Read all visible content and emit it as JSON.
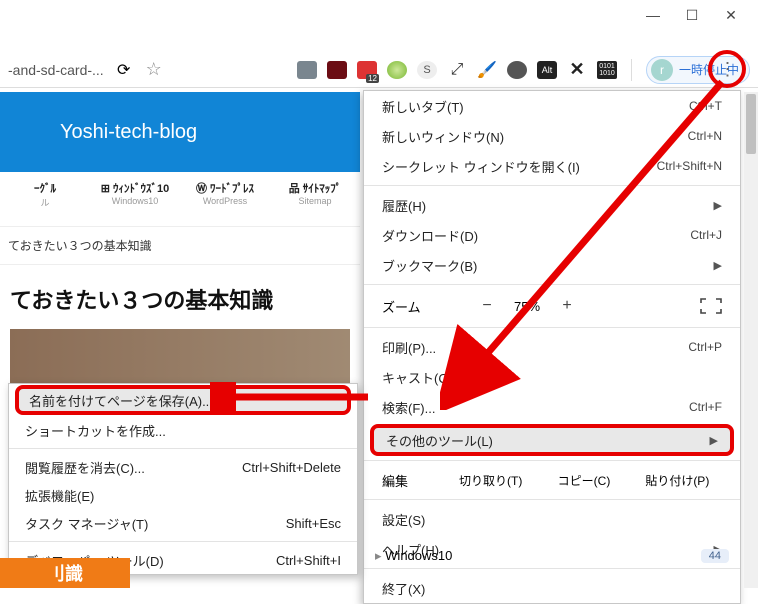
{
  "window": {
    "minimize": "—",
    "maximize": "☐",
    "close": "✕"
  },
  "toolbar": {
    "address_fragment": "-and-sd-card-...",
    "profile_initial": "r",
    "profile_label": "一時停止中"
  },
  "hero": {
    "title": "Yoshi-tech-blog"
  },
  "nav": [
    {
      "icon": "⊞",
      "label": "ｰｸﾞﾙ",
      "sub": "ル"
    },
    {
      "icon": "⊞",
      "label": "ｳｨﾝﾄﾞｳｽﾞ10",
      "sub": "Windows10"
    },
    {
      "icon": "Ⓦ",
      "label": "ﾜｰﾄﾞﾌﾟﾚｽ",
      "sub": "WordPress"
    },
    {
      "icon": "品",
      "label": "ｻｲﾄﾏｯﾌﾟ",
      "sub": "Sitemap"
    }
  ],
  "breadcrumb": "ておきたい３つの基本知識",
  "article": {
    "title": "ておきたい３つの基本知識"
  },
  "main_menu": {
    "new_tab": "新しいタブ(T)",
    "new_tab_sc": "Ctrl+T",
    "new_window": "新しいウィンドウ(N)",
    "new_window_sc": "Ctrl+N",
    "incognito": "シークレット ウィンドウを開く(I)",
    "incognito_sc": "Ctrl+Shift+N",
    "history": "履歴(H)",
    "downloads": "ダウンロード(D)",
    "downloads_sc": "Ctrl+J",
    "bookmarks": "ブックマーク(B)",
    "zoom": "ズーム",
    "zoom_val": "75%",
    "print": "印刷(P)...",
    "print_sc": "Ctrl+P",
    "cast": "キャスト(C)...",
    "find": "検索(F)...",
    "find_sc": "Ctrl+F",
    "more_tools": "その他のツール(L)",
    "edit": "編集",
    "cut": "切り取り(T)",
    "copy": "コピー(C)",
    "paste": "貼り付け(P)",
    "settings": "設定(S)",
    "help": "ヘルプ(H)",
    "exit": "終了(X)"
  },
  "sub_menu": {
    "save_as": "名前を付けてページを保存(A)...",
    "shortcut_create": "ショートカットを作成...",
    "clear_history": "閲覧履歴を消去(C)...",
    "clear_history_sc": "Ctrl+Shift+Delete",
    "extensions": "拡張機能(E)",
    "task_manager": "タスク マネージャ(T)",
    "task_manager_sc": "Shift+Esc",
    "devtools": "デベロッパー ツール(D)",
    "devtools_sc": "Ctrl+Shift+I"
  },
  "below": {
    "label": "Windows10",
    "count": "44"
  },
  "bottom_strip": "刂識"
}
